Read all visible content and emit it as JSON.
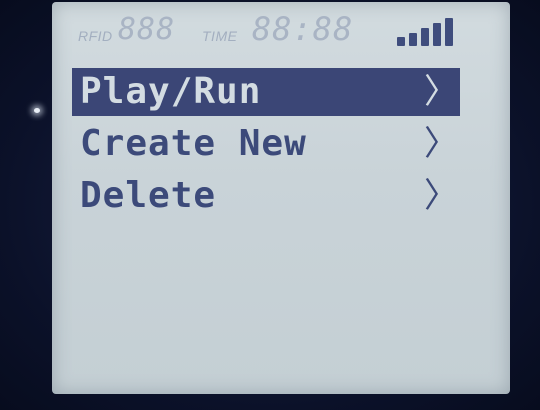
{
  "status": {
    "rfid_label": "RFID",
    "rfid_digits": "888",
    "time_label": "TIME",
    "time_digits": "88:88"
  },
  "menu": {
    "items": [
      {
        "label": "Play/Run",
        "chevron": "〉",
        "selected": true
      },
      {
        "label": "Create New",
        "chevron": "〉",
        "selected": false
      },
      {
        "label": "Delete",
        "chevron": "〉",
        "selected": false
      }
    ]
  },
  "colors": {
    "lcd_background": "#cdd6db",
    "pixel_on": "#3c4a7a",
    "highlight": "#3b4676",
    "segment_ghost": "#a9b4c4",
    "bezel": "#0e1530"
  },
  "icons": {
    "signal": "signal-strength-icon",
    "chevron": "chevron-right-icon"
  }
}
